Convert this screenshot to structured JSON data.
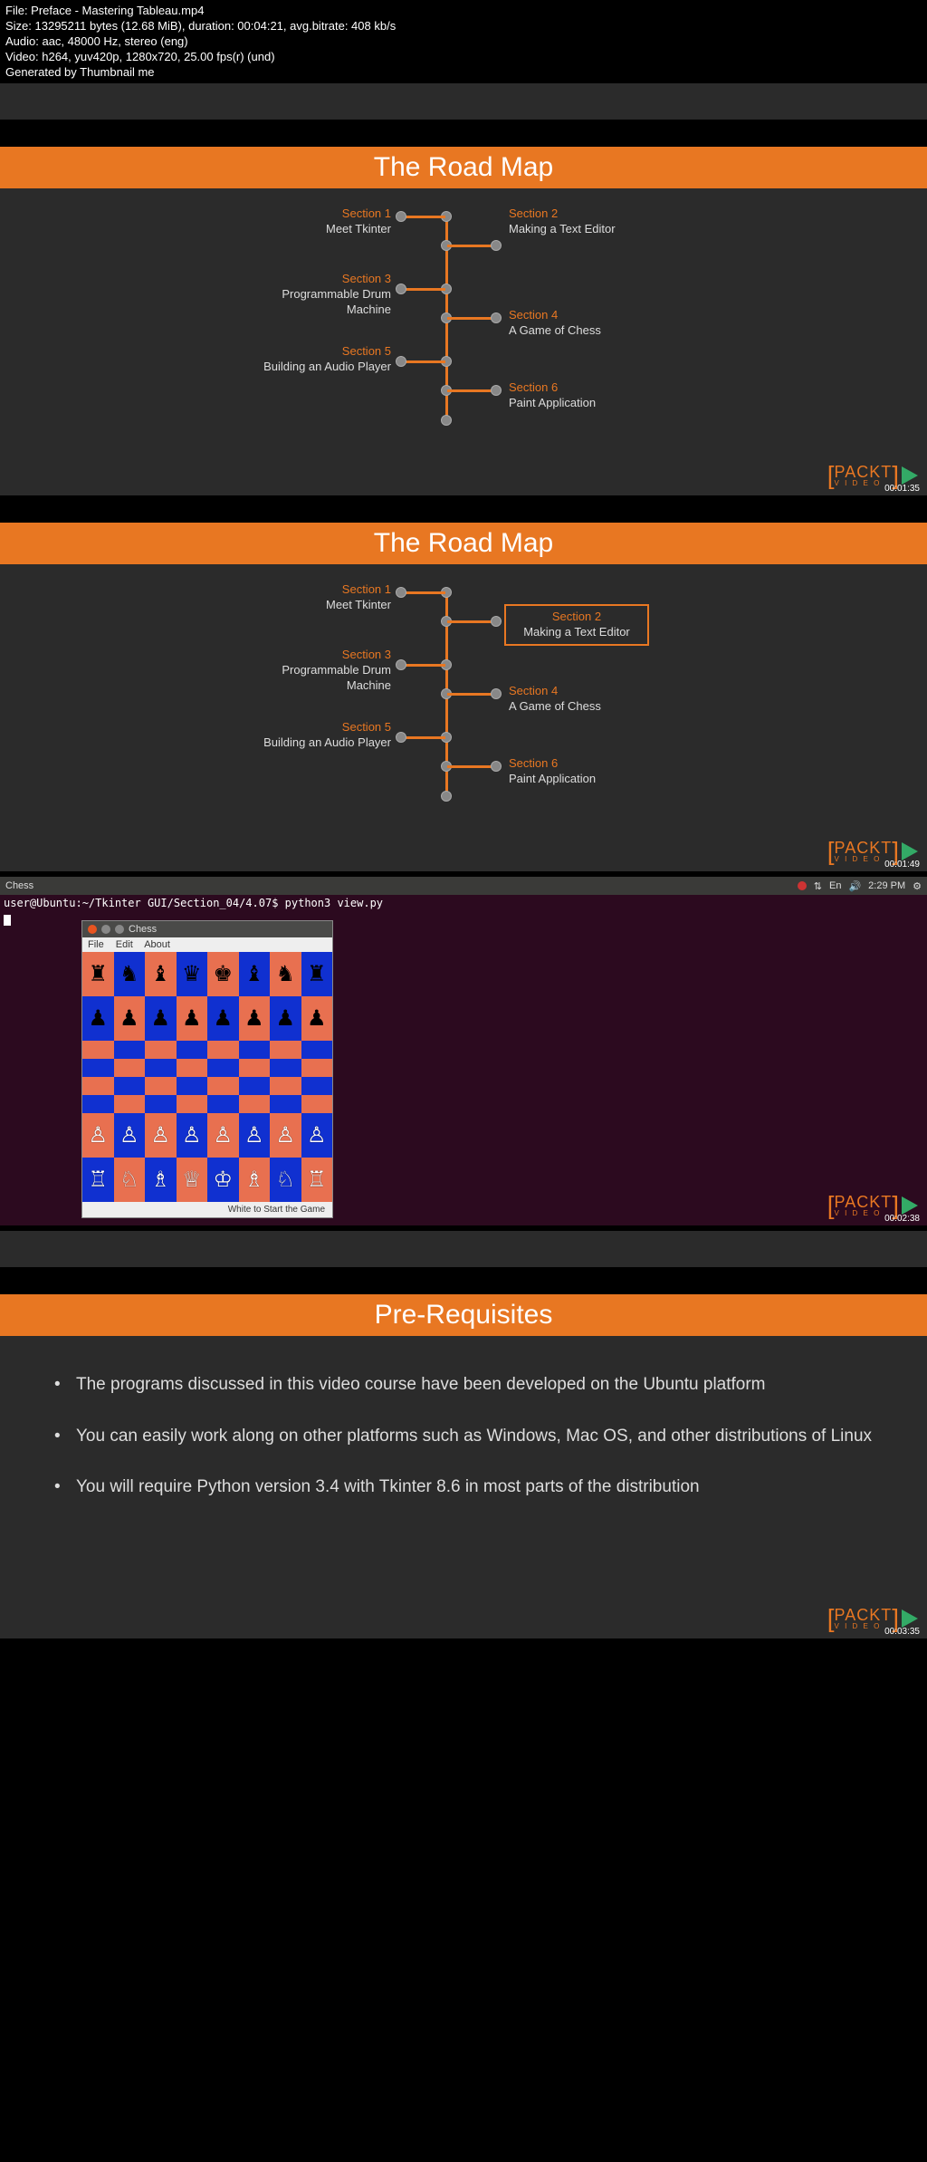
{
  "file_info": {
    "l1": "File: Preface - Mastering Tableau.mp4",
    "l2": "Size: 13295211 bytes (12.68 MiB), duration: 00:04:21, avg.bitrate: 408 kb/s",
    "l3": "Audio: aac, 48000 Hz, stereo (eng)",
    "l4": "Video: h264, yuv420p, 1280x720, 25.00 fps(r) (und)",
    "l5": "Generated by Thumbnail me"
  },
  "roadmap_title": "The Road Map",
  "sections": {
    "s1n": "Section 1",
    "s1t": "Meet Tkinter",
    "s2n": "Section 2",
    "s2t": "Making a Text Editor",
    "s3n": "Section 3",
    "s3t": "Programmable Drum Machine",
    "s4n": "Section 4",
    "s4t": "A Game of Chess",
    "s5n": "Section 5",
    "s5t": "Building an Audio Player",
    "s6n": "Section 6",
    "s6t": "Paint Application"
  },
  "timestamps": {
    "t1": "00:01:35",
    "t2": "00:01:49",
    "t3": "00:02:38",
    "t4": "00:03:35"
  },
  "packt": {
    "name": "PACKT",
    "sub": "V I D E O"
  },
  "ubuntu": {
    "app": "Chess",
    "time": "2:29 PM",
    "lang": "En",
    "prompt": "user@Ubuntu:~/Tkinter GUI/Section_04/4.07$ python3 view.py"
  },
  "chess_win": {
    "title": "Chess",
    "menu_file": "File",
    "menu_edit": "Edit",
    "menu_about": "About",
    "status": "White to Start the Game"
  },
  "prereq_title": "Pre-Requisites",
  "prereq": {
    "b1": "The programs discussed in this video course have been developed on the Ubuntu platform",
    "b2": "You can easily work along on other platforms such as Windows, Mac OS, and other distributions of Linux",
    "b3": "You will require Python version 3.4 with Tkinter 8.6 in most parts of the distribution"
  },
  "pieces": {
    "br": "♜",
    "bn": "♞",
    "bb": "♝",
    "bq": "♛",
    "bk": "♚",
    "bp": "♟",
    "wr": "♖",
    "wn": "♘",
    "wb": "♗",
    "wq": "♕",
    "wk": "♔",
    "wp": "♙"
  }
}
